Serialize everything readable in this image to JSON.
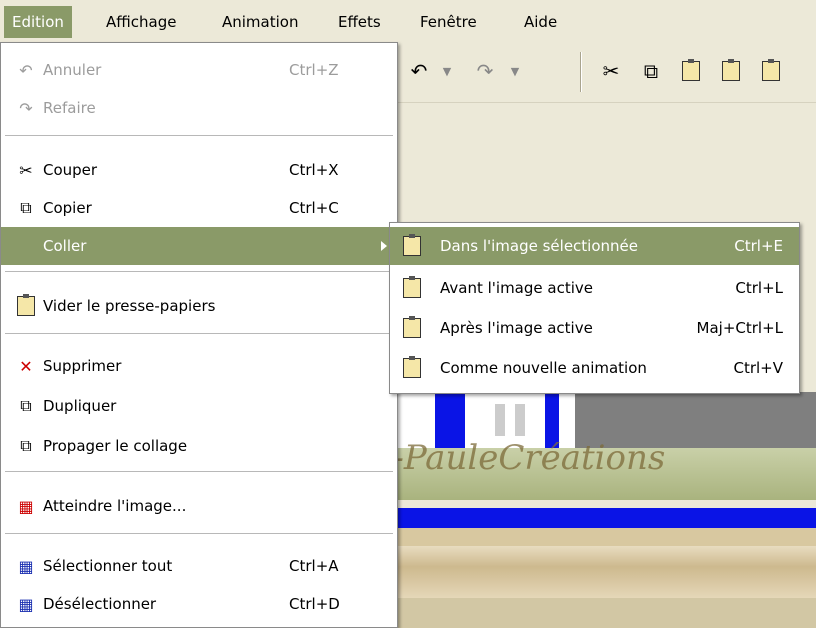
{
  "menubar": {
    "items": [
      "Edition",
      "Affichage",
      "Animation",
      "Effets",
      "Fenêtre",
      "Aide"
    ]
  },
  "toolbar": {
    "icons": [
      "undo-icon",
      "redo-icon",
      "cut-icon",
      "copy-icon",
      "paste-icon",
      "paste-before-icon",
      "paste-after-icon"
    ]
  },
  "edit_menu": {
    "items": [
      {
        "label": "Annuler",
        "shortcut": "Ctrl+Z",
        "icon": "undo-icon",
        "enabled": false
      },
      {
        "label": "Refaire",
        "shortcut": "",
        "icon": "redo-icon",
        "enabled": false
      },
      {
        "label": "Couper",
        "shortcut": "Ctrl+X",
        "icon": "scissors-icon",
        "enabled": true
      },
      {
        "label": "Copier",
        "shortcut": "Ctrl+C",
        "icon": "copy-icon",
        "enabled": true
      },
      {
        "label": "Coller",
        "shortcut": "",
        "icon": "",
        "enabled": true,
        "has_submenu": true
      },
      {
        "label": "Vider le presse-papiers",
        "shortcut": "",
        "icon": "clear-clipboard-icon",
        "enabled": true
      },
      {
        "label": "Supprimer",
        "shortcut": "",
        "icon": "delete-icon",
        "enabled": true
      },
      {
        "label": "Dupliquer",
        "shortcut": "",
        "icon": "duplicate-icon",
        "enabled": true
      },
      {
        "label": "Propager le collage",
        "shortcut": "",
        "icon": "propagate-icon",
        "enabled": true
      },
      {
        "label": "Atteindre l'image...",
        "shortcut": "",
        "icon": "goto-frame-icon",
        "enabled": true
      },
      {
        "label": "Sélectionner tout",
        "shortcut": "Ctrl+A",
        "icon": "select-all-icon",
        "enabled": true
      },
      {
        "label": "Désélectionner",
        "shortcut": "Ctrl+D",
        "icon": "deselect-icon",
        "enabled": true
      }
    ]
  },
  "paste_submenu": {
    "items": [
      {
        "label": "Dans l'image sélectionnée",
        "shortcut": "Ctrl+E",
        "icon": "paste-into-icon"
      },
      {
        "label": "Avant l'image active",
        "shortcut": "Ctrl+L",
        "icon": "paste-before-icon"
      },
      {
        "label": "Après l'image active",
        "shortcut": "Maj+Ctrl+L",
        "icon": "paste-after-icon"
      },
      {
        "label": "Comme nouvelle animation",
        "shortcut": "Ctrl+V",
        "icon": "paste-new-animation-icon"
      }
    ]
  },
  "watermark": "Marie-PauleCréations",
  "colors": {
    "highlight": "#8a9a68",
    "menu_bg": "#ffffff",
    "disabled": "#9c9c9c",
    "chrome": "#ece9d8"
  }
}
